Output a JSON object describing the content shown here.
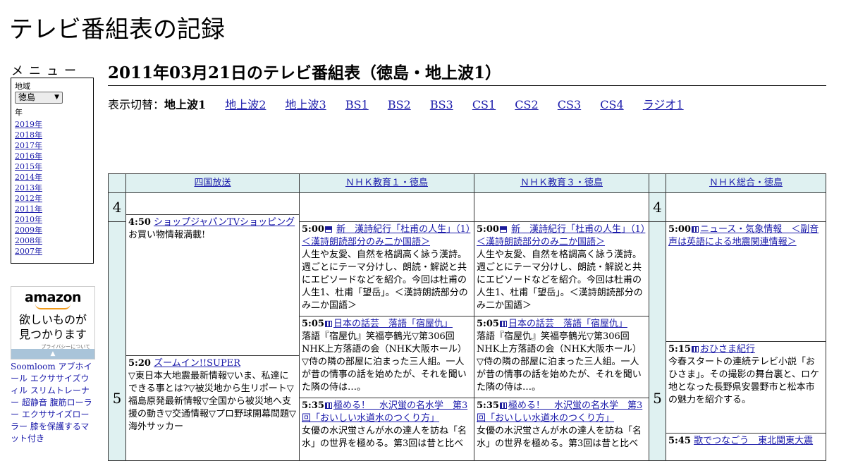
{
  "site_title": "テレビ番組表の記録",
  "menu": {
    "heading": "メニュー",
    "region_label": "地域",
    "region_value": "徳島",
    "year_label": "年",
    "years": [
      "2019年",
      "2018年",
      "2017年",
      "2016年",
      "2015年",
      "2014年",
      "2013年",
      "2012年",
      "2011年",
      "2010年",
      "2009年",
      "2008年",
      "2007年"
    ]
  },
  "ad": {
    "logo": "amazon",
    "tagline_1": "欲しいものが",
    "tagline_2": "見つかります",
    "privacy": "プライバシーについて",
    "toggle_icon": "up-arrow",
    "links_text": "Soomloom アブホイール エクササイズウィル スリムトレーナー 超静音 腹筋ローラー エクササイズローラー 膝を保護するマット付き"
  },
  "page_heading": "2011年03月21日のテレビ番組表（徳島・地上波1）",
  "switcher": {
    "label": "表示切替：",
    "current": "地上波1",
    "links": [
      "地上波2",
      "地上波3",
      "BS1",
      "BS2",
      "BS3",
      "CS1",
      "CS2",
      "CS3",
      "CS4",
      "ラジオ1"
    ]
  },
  "schedule": {
    "channels": [
      "四国放送",
      "ＮＨＫ教育１・徳島",
      "ＮＨＫ教育３・徳島",
      "ＮＨＫ総合・徳島"
    ],
    "hours": [
      "4",
      "5"
    ],
    "hours_right": [
      "4",
      "5"
    ],
    "ch1": [
      {
        "time": "4:50",
        "title": "ショップジャパンTVショッピング",
        "desc": "お買い物情報満載!"
      },
      {
        "time": "5:20",
        "title": "ズームイン!!SUPER",
        "desc": "▽東日本大地震最新情報▽いま、私達にできる事とは?▽被災地から生リポート▽福島原発最新情報▽全国から被災地へ支援の動き▽交通情報▽プロ野球開幕問題▽海外サッカー"
      }
    ],
    "ch2": [
      {
        "time": "5:00",
        "icon": "subtitle-icon",
        "title": "新　漢詩紀行「杜甫の人生」（1）＜漢詩朗読部分のみ二か国語＞",
        "desc": "人生や友愛、自然を格調高く詠う漢詩。週ごとにテーマ分けし、朗読・解説と共にエピソードなどを紹介。今回は杜甫の人生1、杜甫「望岳」。＜漢詩朗読部分のみ二か国語＞"
      },
      {
        "time": "5:05",
        "icon": "data-icon",
        "title": "日本の話芸　落語「宿屋仇」",
        "desc": "落語『宿屋仇』笑福亭鶴光▽第306回NHK上方落語の会（NHK大阪ホール）▽侍の隣の部屋に泊まった三人組。一人が昔の情事の話を始めたが、それを聞いた隣の侍は…。"
      },
      {
        "time": "5:35",
        "icon": "data-icon",
        "title": "極める！　水沢蛍の名水学　第3回「おいしい水道水のつくり方」",
        "desc": "女優の水沢蛍さんが水の達人を訪ね「名水」の世界を極める。第3回は昔と比べ"
      }
    ],
    "ch3": [
      {
        "time": "5:00",
        "icon": "subtitle-icon",
        "title": "新　漢詩紀行「杜甫の人生」（1）＜漢詩朗読部分のみ二か国語＞",
        "desc": "人生や友愛、自然を格調高く詠う漢詩。週ごとにテーマ分けし、朗読・解説と共にエピソードなどを紹介。今回は杜甫の人生1、杜甫「望岳」。＜漢詩朗読部分のみ二か国語＞"
      },
      {
        "time": "5:05",
        "icon": "data-icon",
        "title": "日本の話芸　落語「宿屋仇」",
        "desc": "落語『宿屋仇』笑福亭鶴光▽第306回NHK上方落語の会（NHK大阪ホール）▽侍の隣の部屋に泊まった三人組。一人が昔の情事の話を始めたが、それを聞いた隣の侍は…。"
      },
      {
        "time": "5:35",
        "icon": "data-icon",
        "title": "極める！　水沢蛍の名水学　第3回「おいしい水道水のつくり方」",
        "desc": "女優の水沢蛍さんが水の達人を訪ね「名水」の世界を極める。第3回は昔と比べ"
      }
    ],
    "ch4": [
      {
        "time": "5:00",
        "icon": "data-icon",
        "title": "ニュース・気象情報　＜副音声は英語による地震関連情報＞",
        "desc": ""
      },
      {
        "time": "5:15",
        "icon": "data-icon",
        "title": "おひさま紀行",
        "desc": "今春スタートの連続テレビ小説「おひさま」。その撮影の舞台裏と、ロケ地となった長野県安曇野市と松本市の魅力を紹介する。"
      },
      {
        "time": "5:45",
        "icon": "",
        "title": "歌でつなごう　東北関東大震",
        "desc": ""
      }
    ]
  }
}
